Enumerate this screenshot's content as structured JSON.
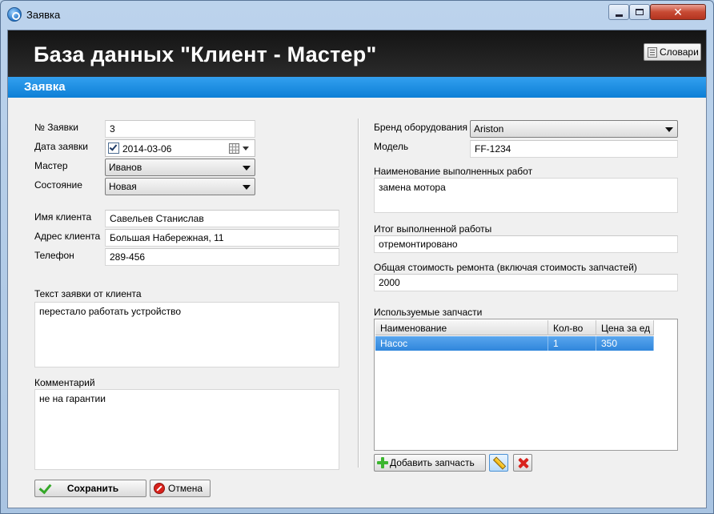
{
  "window": {
    "title": "Заявка",
    "app_icon": "app-logo-icon",
    "controls": {
      "minimize": "minimize-icon",
      "maximize": "maximize-icon",
      "close": "close-icon",
      "close_glyph": "✕"
    }
  },
  "header": {
    "title": "База данных \"Клиент - Мастер\"",
    "section": "Заявка",
    "dictionaries_button": "Словари",
    "accent_color": "#1a8ae0"
  },
  "left": {
    "order_no": {
      "label": "№ Заявки",
      "value": "3"
    },
    "order_date": {
      "label": "Дата заявки",
      "value": "2014-03-06",
      "checked": true
    },
    "master": {
      "label": "Мастер",
      "value": "Иванов"
    },
    "status": {
      "label": "Состояние",
      "value": "Новая"
    },
    "client_name": {
      "label": "Имя клиента",
      "value": "Савельев Станислав"
    },
    "client_address": {
      "label": "Адрес клиента",
      "value": "Большая Набережная, 11"
    },
    "phone": {
      "label": "Телефон",
      "value": "289-456"
    },
    "request_text": {
      "label": "Текст заявки от клиента",
      "value": "перестало работать устройство"
    },
    "comment": {
      "label": "Комментарий",
      "value": "не на гарантии"
    }
  },
  "right": {
    "brand": {
      "label": "Бренд оборудования",
      "value": "Ariston"
    },
    "model": {
      "label": "Модель",
      "value": "FF-1234"
    },
    "work_done": {
      "label": "Наименование выполненных работ",
      "value": "замена мотора"
    },
    "work_result": {
      "label": "Итог выполненной работы",
      "value": "отремонтировано"
    },
    "total_cost": {
      "label": "Общая стоимость ремонта (включая стоимость запчастей)",
      "value": "2000"
    },
    "parts": {
      "label": "Используемые запчасти",
      "columns": [
        "Наименование",
        "Кол-во",
        "Цена за ед"
      ],
      "rows": [
        {
          "name": "Насос",
          "qty": "1",
          "price": "350"
        }
      ],
      "add_button": "Добавить запчасть"
    }
  },
  "footer": {
    "save_button": "Сохранить",
    "cancel_button": "Отмена"
  }
}
